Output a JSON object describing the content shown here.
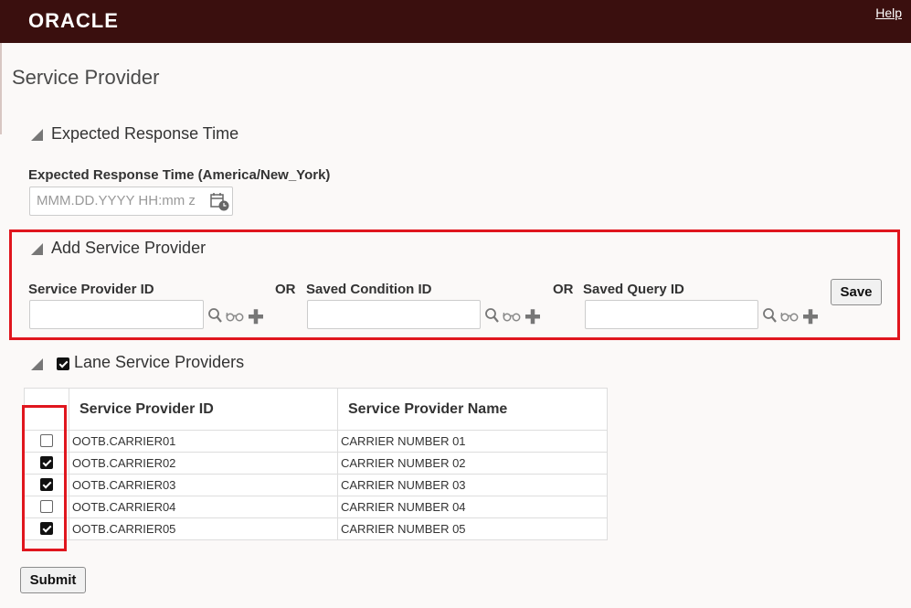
{
  "header": {
    "logo": "ORACLE",
    "help": "Help"
  },
  "page_title": "Service Provider",
  "expected": {
    "section_title": "Expected Response Time",
    "field_label": "Expected Response Time (America/New_York)",
    "placeholder": "MMM.DD.YYYY HH:mm z",
    "calendar_icon": "calendar-clock-icon"
  },
  "add": {
    "section_title": "Add Service Provider",
    "provider_id_label": "Service Provider ID",
    "or_label": "OR",
    "condition_id_label": "Saved Condition ID",
    "query_id_label": "Saved Query ID",
    "save_label": "Save",
    "icons": [
      "search-icon",
      "glasses-icon",
      "plus-icon"
    ]
  },
  "lane": {
    "section_title": "Lane Service Providers",
    "section_checked": true,
    "columns": [
      "Service Provider ID",
      "Service Provider Name"
    ],
    "rows": [
      {
        "checked": false,
        "id": "OOTB.CARRIER01",
        "name": "CARRIER NUMBER 01"
      },
      {
        "checked": true,
        "id": "OOTB.CARRIER02",
        "name": "CARRIER NUMBER 02"
      },
      {
        "checked": true,
        "id": "OOTB.CARRIER03",
        "name": "CARRIER NUMBER 03"
      },
      {
        "checked": false,
        "id": "OOTB.CARRIER04",
        "name": "CARRIER NUMBER 04"
      },
      {
        "checked": true,
        "id": "OOTB.CARRIER05",
        "name": "CARRIER NUMBER 05"
      }
    ]
  },
  "submit_label": "Submit",
  "colors": {
    "header_bg": "#3a0f0e",
    "highlight": "#e0161e"
  }
}
